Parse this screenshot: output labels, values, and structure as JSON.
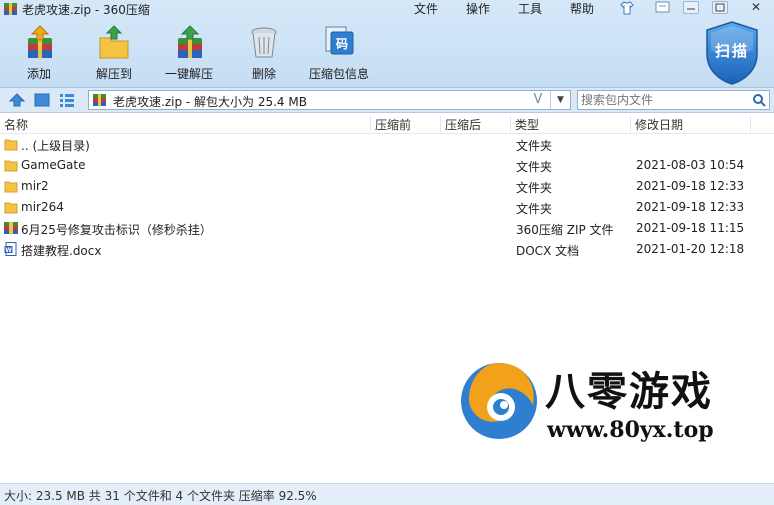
{
  "window": {
    "title": "老虎攻速.zip - 360压缩"
  },
  "menu": {
    "file": "文件",
    "operation": "操作",
    "tools": "工具",
    "help": "帮助",
    "close": "✕"
  },
  "toolbar": {
    "add": "添加",
    "extract_to": "解压到",
    "one_click_extract": "一键解压",
    "delete": "删除",
    "zip_info": "压缩包信息",
    "scan": "扫描"
  },
  "address": {
    "path": "老虎攻速.zip - 解包大小为 25.4 MB",
    "dropdown_glyph": "V"
  },
  "search": {
    "placeholder": "搜索包内文件"
  },
  "columns": {
    "name": "名称",
    "compressed_before": "压缩前",
    "compressed_after": "压缩后",
    "type": "类型",
    "modified": "修改日期"
  },
  "files": [
    {
      "name": ".. (上级目录)",
      "type": "文件夹",
      "date": "",
      "icon": "folder-icon"
    },
    {
      "name": "GameGate",
      "type": "文件夹",
      "date": "2021-08-03 10:54",
      "icon": "folder-icon"
    },
    {
      "name": "mir2",
      "type": "文件夹",
      "date": "2021-09-18 12:33",
      "icon": "folder-icon"
    },
    {
      "name": "mir264",
      "type": "文件夹",
      "date": "2021-09-18 12:33",
      "icon": "folder-icon"
    },
    {
      "name": "6月25号修复攻击标识（修秒杀挂）",
      "type": "360压缩 ZIP 文件",
      "date": "2021-09-18 11:15",
      "icon": "zip-file-icon"
    },
    {
      "name": "搭建教程.docx",
      "type": "DOCX 文档",
      "date": "2021-01-20 12:18",
      "icon": "word-doc-icon"
    }
  ],
  "watermark": {
    "title": "八零游戏",
    "url": "www.80yx.top"
  },
  "status": {
    "text": "大小: 23.5 MB 共 31 个文件和 4 个文件夹 压缩率 92.5%"
  },
  "colors": {
    "accent": "#2f7fd0",
    "toolbar_bg": "#cfe4f7",
    "folder": "#f5c242"
  }
}
